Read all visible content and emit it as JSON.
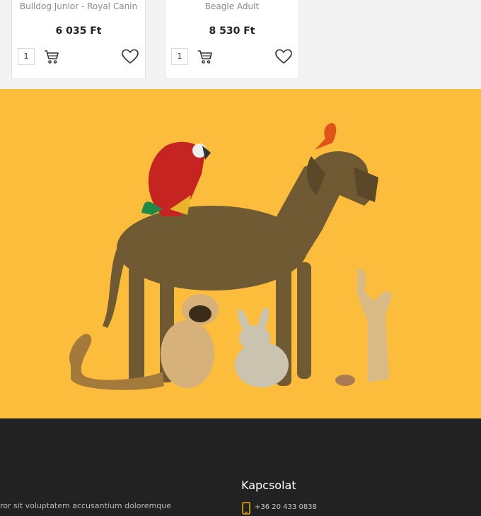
{
  "products": [
    {
      "name": "Bulldog Junior - Royal Canin",
      "price": "6 035 Ft",
      "quantity": "1"
    },
    {
      "name": "Beagle Adult",
      "price": "8 530 Ft",
      "quantity": "1"
    }
  ],
  "banner": {
    "background_color": "#fbbd3b",
    "illustration": "pets-group-image"
  },
  "footer": {
    "lorem_text": "ror sit voluptatem accusantium doloremque",
    "contact_heading": "Kapcsolat",
    "phone": "+36 20 433 0838",
    "accent_color": "#f5b301"
  }
}
